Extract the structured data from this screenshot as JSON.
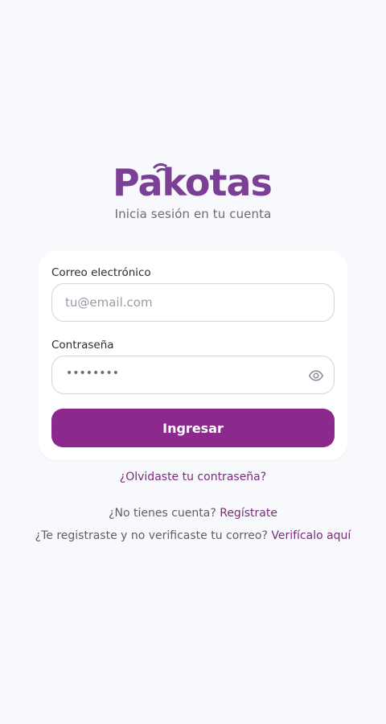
{
  "brand": {
    "name": "Pakotas",
    "color": "#7b3f95"
  },
  "subtitle": "Inicia sesión en tu cuenta",
  "form": {
    "email_label": "Correo electrónico",
    "email_placeholder": "tu@email.com",
    "password_label": "Contraseña",
    "password_value": "••••••••",
    "toggle_icon": "eye-icon",
    "submit_label": "Ingresar",
    "submit_color": "#8b2a8c"
  },
  "links": {
    "forgot_password": "¿Olvidaste tu contraseña?",
    "no_account_text": "¿No tienes cuenta?",
    "register": "Regístrate",
    "unverified_text": "¿Te registraste y no verificaste tu correo?",
    "verify": "Verifícalo aquí"
  }
}
